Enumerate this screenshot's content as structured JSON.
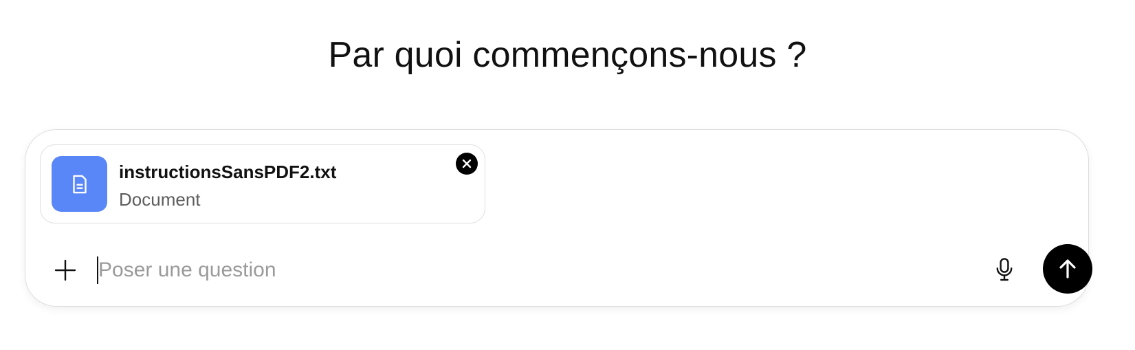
{
  "heading": "Par quoi commençons-nous ?",
  "attachment": {
    "file_name": "instructionsSansPDF2.txt",
    "file_type": "Document",
    "icon": "document-icon",
    "tile_color": "#5a87f8",
    "remove_icon": "close-icon"
  },
  "composer": {
    "input_value": "",
    "input_placeholder": "Poser une question",
    "add_icon": "plus-icon",
    "voice_icon": "microphone-icon",
    "send_icon": "arrow-up-icon"
  }
}
